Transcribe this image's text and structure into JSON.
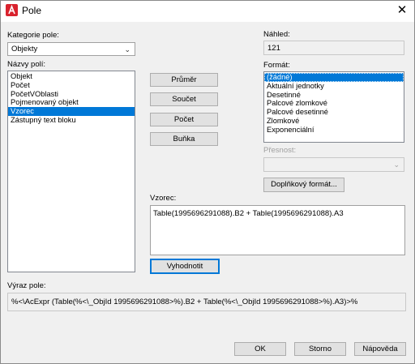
{
  "window": {
    "title": "Pole",
    "close_glyph": "✕"
  },
  "category": {
    "label": "Kategorie pole:",
    "value": "Objekty"
  },
  "field_names": {
    "label": "Názvy polí:",
    "items": [
      "Objekt",
      "Počet",
      "PočetVOblasti",
      "Pojmenovaný objekt",
      "Vzorec",
      "Zástupný text bloku"
    ],
    "selected": "Vzorec"
  },
  "buttons": {
    "average": "Průměr",
    "sum": "Součet",
    "count": "Počet",
    "cell": "Buňka",
    "evaluate": "Vyhodnotit",
    "additional_format": "Doplňkový formát...",
    "ok": "OK",
    "cancel": "Storno",
    "help": "Nápověda"
  },
  "preview": {
    "label": "Náhled:",
    "value": "121"
  },
  "format": {
    "label": "Formát:",
    "items": [
      "(žádné)",
      "Aktuální jednotky",
      "Desetinné",
      "Palcové zlomkové",
      "Palcové desetinné",
      "Zlomkové",
      "Exponenciální"
    ],
    "selected": "(žádné)"
  },
  "precision": {
    "label": "Přesnost:",
    "value": ""
  },
  "formula": {
    "label": "Vzorec:",
    "value": "Table(1995696291088).B2 + Table(1995696291088).A3"
  },
  "expression": {
    "label": "Výraz pole:",
    "value": "%<\\AcExpr (Table(%<\\_ObjId 1995696291088>%).B2 + Table(%<\\_ObjId 1995696291088>%).A3)>%"
  },
  "colors": {
    "selection": "#0078d7",
    "app_icon": "#d9232e"
  }
}
